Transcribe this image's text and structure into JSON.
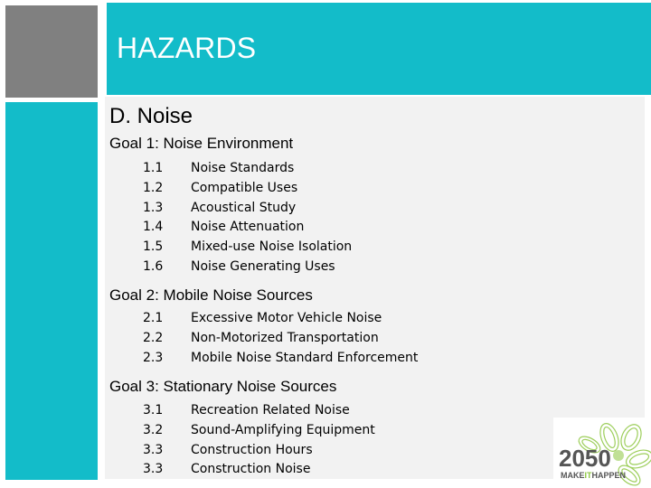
{
  "slide": {
    "title": "HAZARDS",
    "section": "D. Noise",
    "goals": [
      {
        "heading": "Goal 1: Noise Environment",
        "items": [
          {
            "num": "1.1",
            "label": "Noise Standards"
          },
          {
            "num": "1.2",
            "label": "Compatible Uses"
          },
          {
            "num": "1.3",
            "label": "Acoustical Study"
          },
          {
            "num": "1.4",
            "label": "Noise Attenuation"
          },
          {
            "num": "1.5",
            "label": "Mixed-use Noise Isolation"
          },
          {
            "num": "1.6",
            "label": "Noise Generating Uses"
          }
        ]
      },
      {
        "heading": "Goal 2: Mobile Noise Sources",
        "items": [
          {
            "num": "2.1",
            "label": "Excessive Motor Vehicle Noise"
          },
          {
            "num": "2.2",
            "label": "Non-Motorized Transportation"
          },
          {
            "num": "2.3",
            "label": "Mobile Noise Standard Enforcement"
          }
        ]
      },
      {
        "heading": "Goal 3: Stationary Noise Sources",
        "items": [
          {
            "num": "3.1",
            "label": "Recreation Related Noise"
          },
          {
            "num": "3.2",
            "label": "Sound-Amplifying Equipment"
          },
          {
            "num": "3.3",
            "label": "Construction Hours"
          },
          {
            "num": "3.3",
            "label": "Construction Noise"
          }
        ]
      }
    ]
  },
  "logo": {
    "year": "2050",
    "tagline_pre": "MAKE",
    "tagline_mid": "IT",
    "tagline_post": "HAPPEN",
    "icon": "leaf-flower-icon"
  },
  "colors": {
    "accent": "#13bcc9",
    "gray_block": "#808080",
    "panel": "#f2f2f2",
    "logo_text": "#555555",
    "logo_leaf": "#8cc63f"
  }
}
